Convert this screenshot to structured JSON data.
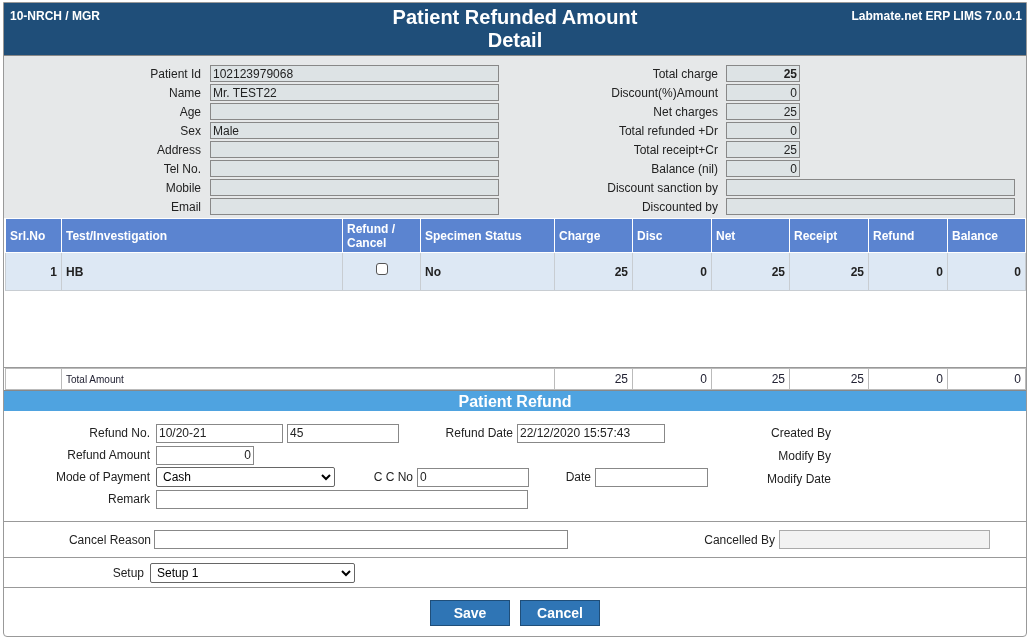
{
  "header": {
    "user": "10-NRCH / MGR",
    "title": "Patient Refunded Amount Detail",
    "app": "Labmate.net ERP LIMS 7.0.0.1"
  },
  "patient": [
    {
      "label": "Patient Id",
      "value": "102123979068"
    },
    {
      "label": "Name",
      "value": "Mr. TEST22"
    },
    {
      "label": "Age"
    },
    {
      "label": "Sex",
      "value": "Male"
    },
    {
      "label": "Address"
    },
    {
      "label": "Tel No."
    },
    {
      "label": "Mobile"
    },
    {
      "label": "Email"
    }
  ],
  "summary": [
    {
      "label": "Total charge",
      "value": "25",
      "kind": "amount",
      "bold": true
    },
    {
      "label": "Discount(%)Amount",
      "value": "0",
      "kind": "amount",
      "bold": false
    },
    {
      "label": "Net charges",
      "value": "25",
      "kind": "amount",
      "bold": false
    },
    {
      "label": "Total refunded +Dr",
      "value": "0",
      "kind": "amount",
      "bold": false
    },
    {
      "label": "Total receipt+Cr",
      "value": "25",
      "kind": "amount",
      "bold": false
    },
    {
      "label": "Balance (nil)",
      "value": "0",
      "kind": "amount",
      "bold": false
    },
    {
      "label": "Discount sanction by",
      "kind": "text"
    },
    {
      "label": "Discounted by",
      "kind": "text"
    }
  ],
  "table": {
    "columns": [
      "Srl.No",
      "Test/Investigation",
      "Refund / Cancel",
      "Specimen Status",
      "Charge",
      "Disc",
      "Net",
      "Receipt",
      "Refund",
      "Balance"
    ],
    "rows": [
      {
        "srl": "1",
        "test": "HB",
        "refund_cancel": false,
        "specimen_status": "No",
        "amounts": [
          "25",
          "0",
          "25",
          "25",
          "0",
          "0"
        ]
      }
    ],
    "total": {
      "label": "Total Amount",
      "values": [
        "25",
        "0",
        "25",
        "25",
        "0",
        "0"
      ]
    }
  },
  "refund": {
    "title": "Patient Refund",
    "refund_no_label": "Refund No.",
    "refund_no_prefix": "10/20-21",
    "refund_no": "45",
    "refund_date_label": "Refund Date",
    "refund_date": "22/12/2020 15:57:43",
    "refund_amount_label": "Refund Amount",
    "refund_amount": "0",
    "mode_label": "Mode of Payment",
    "mode": "Cash",
    "cc_label": "C C No",
    "cc_no": "0",
    "date_label": "Date",
    "remark_label": "Remark",
    "audit_labels": [
      "Created By",
      "Modify By",
      "Modify Date"
    ],
    "cancel_reason_label": "Cancel Reason",
    "cancelled_by_label": "Cancelled By",
    "setup_label": "Setup",
    "setup": "Setup 1"
  },
  "buttons": [
    "Save",
    "Cancel"
  ]
}
